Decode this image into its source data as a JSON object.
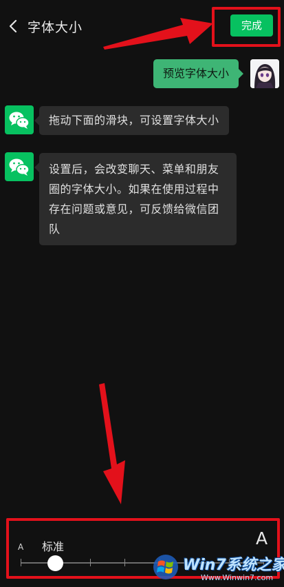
{
  "header": {
    "title": "字体大小",
    "done_label": "完成"
  },
  "chat": {
    "self_message": "预览字体大小",
    "messages": [
      "拖动下面的滑块，可设置字体大小",
      "设置后，会改变聊天、菜单和朋友圈的字体大小。如果在使用过程中存在问题或意见，可反馈给微信团队"
    ]
  },
  "font_slider": {
    "small_label": "A",
    "large_label": "A",
    "current_level_label": "标准",
    "tick_count": 8,
    "selected_index": 1
  },
  "watermark": {
    "brand": "Win7系统之家",
    "url": "Www.Winwin7.com"
  },
  "colors": {
    "accent_green": "#07c160",
    "bubble_green": "#3eb575",
    "highlight_red": "#e3111b",
    "background": "#111111"
  }
}
